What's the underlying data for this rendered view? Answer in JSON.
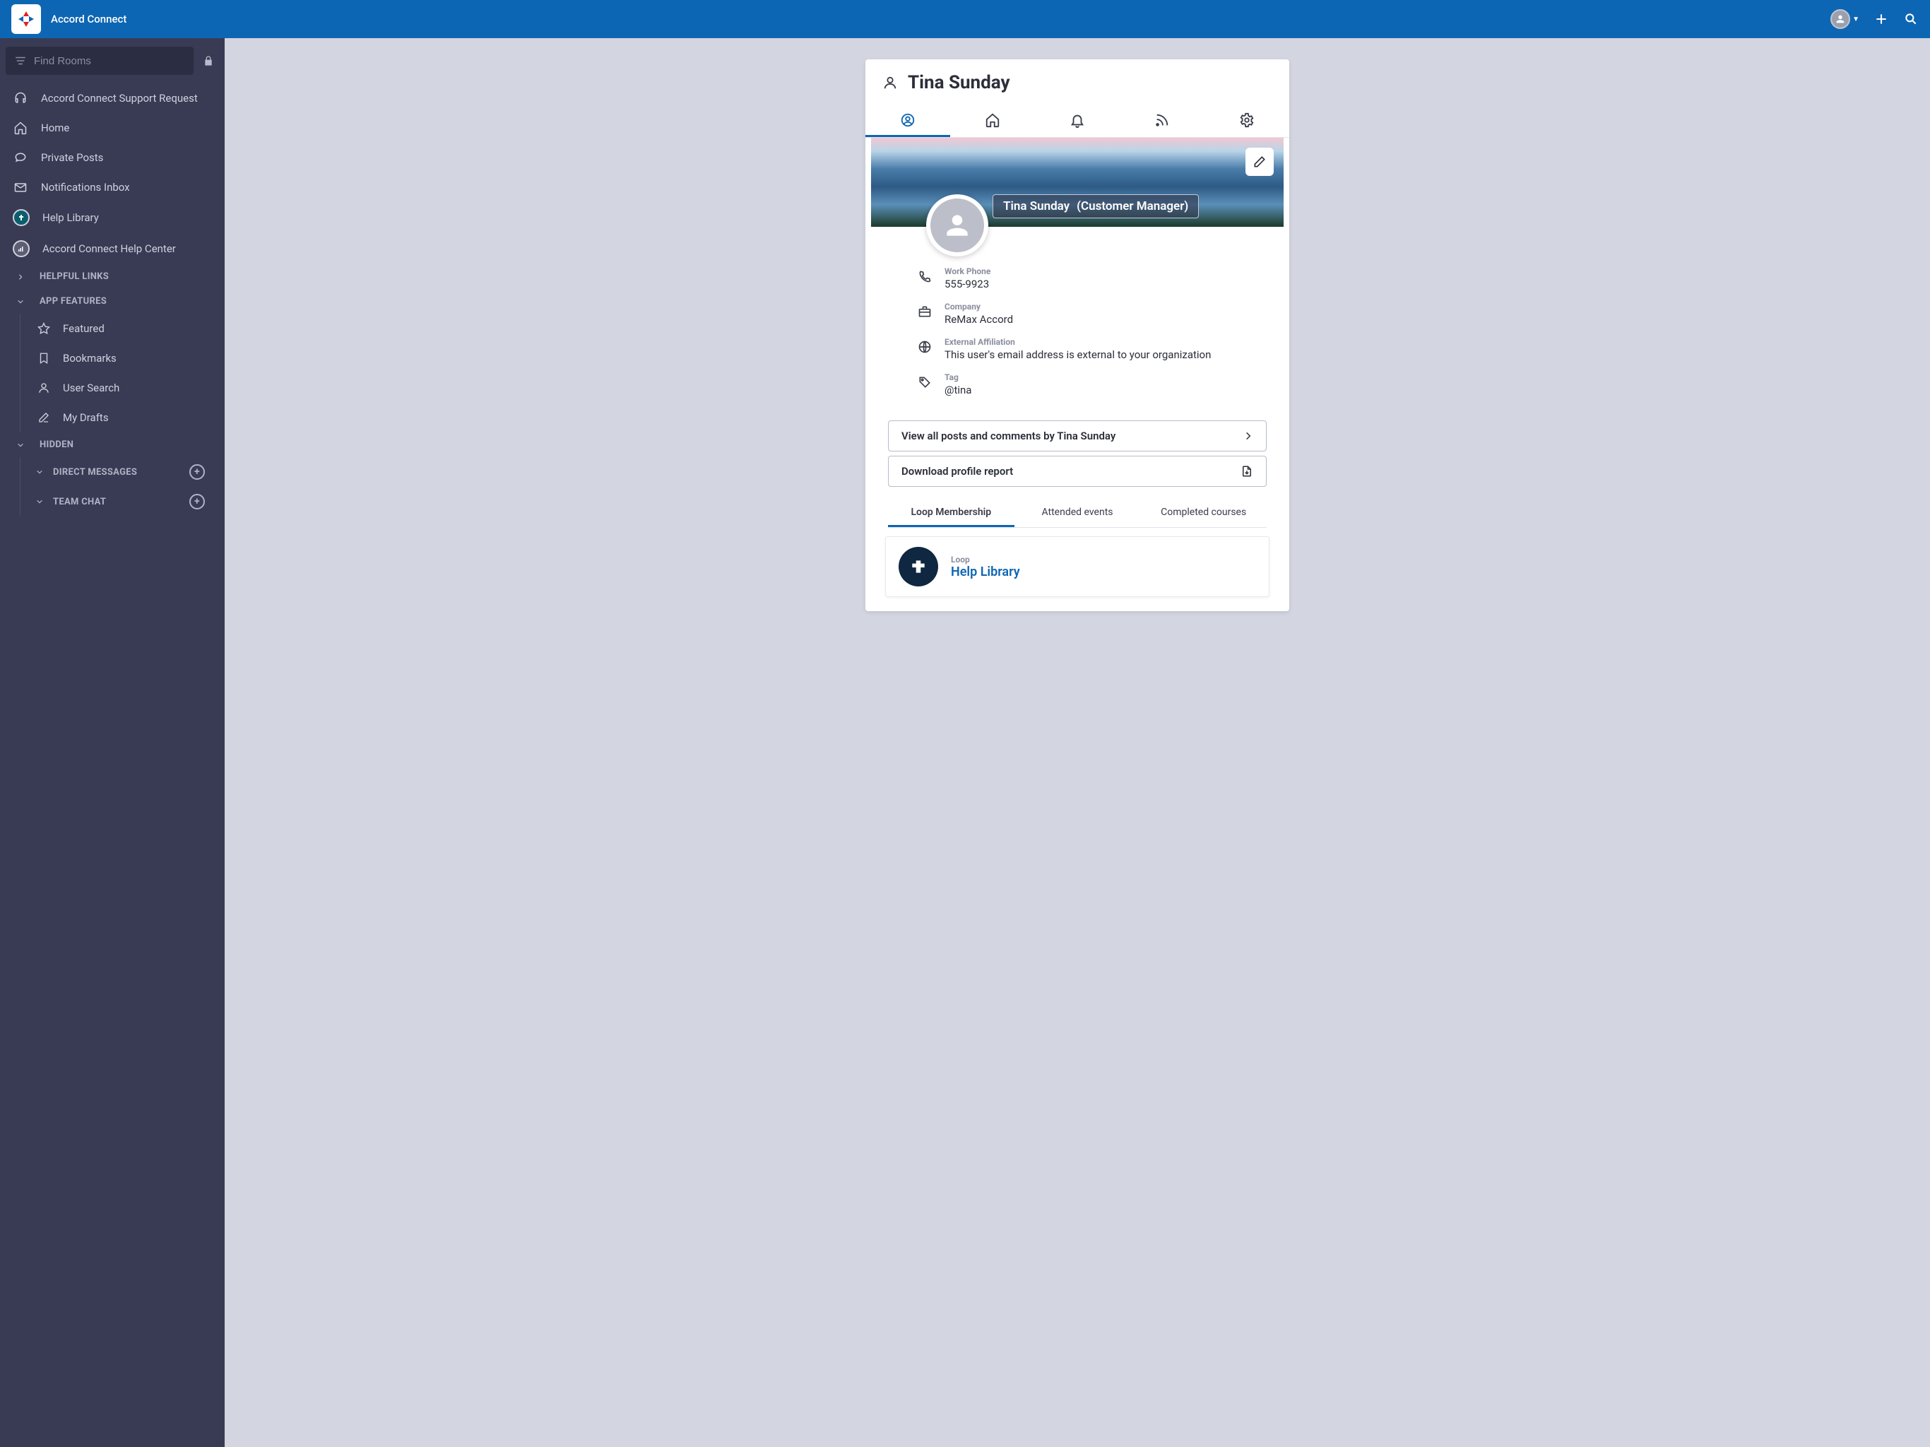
{
  "app": {
    "title": "Accord Connect"
  },
  "search": {
    "placeholder": "Find Rooms"
  },
  "nav": {
    "support": "Accord Connect Support Request",
    "home": "Home",
    "private": "Private Posts",
    "inbox": "Notifications Inbox",
    "help_library": "Help Library",
    "help_center": "Accord Connect Help Center"
  },
  "sections": {
    "helpful_links": "HELPFUL LINKS",
    "app_features": "APP FEATURES",
    "hidden": "HIDDEN",
    "direct_messages": "DIRECT MESSAGES",
    "team_chat": "TEAM CHAT"
  },
  "features": {
    "featured": "Featured",
    "bookmarks": "Bookmarks",
    "user_search": "User Search",
    "drafts": "My Drafts"
  },
  "profile": {
    "name": "Tina Sunday",
    "role": "(Customer Manager)",
    "fields": {
      "phone_label": "Work Phone",
      "phone_value": "555-9923",
      "company_label": "Company",
      "company_value": "ReMax Accord",
      "affiliation_label": "External Affiliation",
      "affiliation_value": "This user's email address is external to your organization",
      "tag_label": "Tag",
      "tag_value": "@tina"
    },
    "actions": {
      "view_posts": "View all posts and comments by Tina Sunday",
      "download_report": "Download profile report"
    },
    "subtabs": {
      "loop": "Loop Membership",
      "attended": "Attended events",
      "completed": "Completed courses"
    },
    "loop_card": {
      "label": "Loop",
      "name": "Help Library"
    }
  }
}
